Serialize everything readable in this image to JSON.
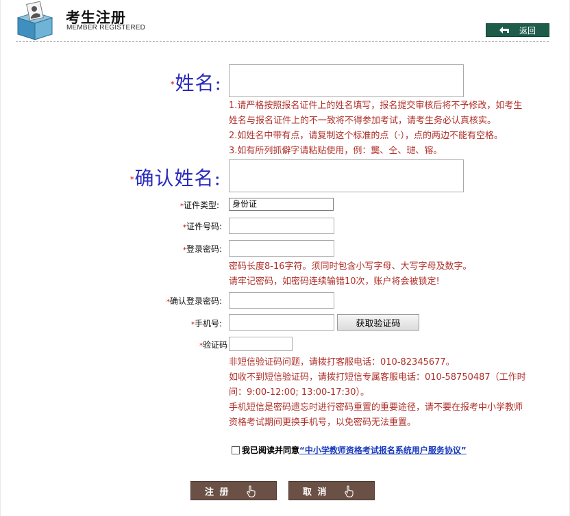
{
  "header": {
    "title": "考生注册",
    "subtitle": "MEMBER REGISTERED",
    "back_label": "返回"
  },
  "form": {
    "required_mark": "*",
    "name_label": "姓名:",
    "name_hints": [
      "1.请严格按照报名证件上的姓名填写，报名提交审核后将不予修改，如考生",
      "姓名与报名证件上的不一致将不得参加考试，请考生务必认真核实。",
      "2.如姓名中带有点，请复制这个标准的点（·），点的两边不能有空格。",
      "3.如有所列抓僻字请粘贴使用，例：龑、仝、琎、镕。"
    ],
    "confirm_name_label": "确认姓名:",
    "id_type_label": "证件类型:",
    "id_type_value": "身份证",
    "id_number_label": "证件号码:",
    "password_label": "登录密码:",
    "password_hints": [
      "密码长度8-16字符。须同时包含小写字母、大写字母及数字。",
      "请牢记密码，如密码连续输错10次，账户将会被锁定!"
    ],
    "confirm_password_label": "确认登录密码:",
    "phone_label": "手机号:",
    "get_code_button": "获取验证码",
    "code_label": "验证码",
    "code_hints": [
      "非短信验证码问题，请拨打客服电话：010-82345677。",
      "如收不到短信验证码，请拨打短信专属客服电话：010-58750487（工作时",
      "间：9:00-12:00; 13:00-17:30）。",
      "手机短信是密码遗忘时进行密码重置的重要途径，请不要在报考中小学教师",
      "资格考试期间更换手机号，以免密码无法重置。"
    ],
    "agree_text": "我已阅读并同意",
    "agree_link": "“中小学教师资格考试报名系统用户服务协议”",
    "register_button": "注 册",
    "cancel_button": "取 消"
  },
  "colors": {
    "label_blue": "#2b2bbd",
    "hint_red": "#b0302a",
    "back_button_green": "#1e5c4a",
    "action_button_brown": "#6b5145"
  },
  "icons": [
    "member-logo-icon",
    "back-arrow-icon",
    "hand-cursor-icon",
    "dropdown-arrow-icon"
  ]
}
